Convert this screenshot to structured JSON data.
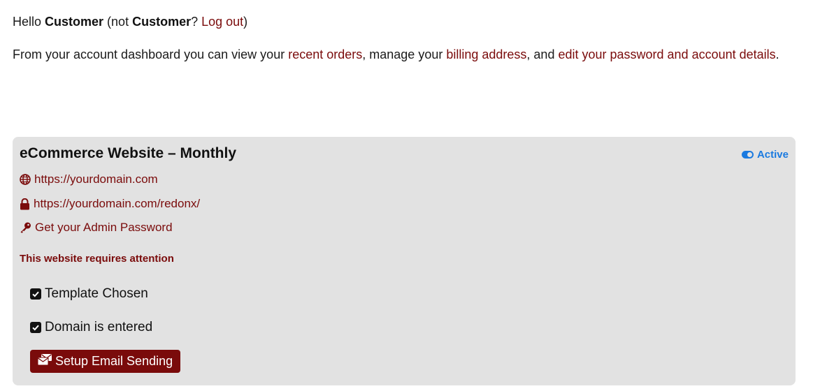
{
  "greeting": {
    "hello": "Hello ",
    "name": "Customer",
    "not_prefix": " (not ",
    "name2": "Customer",
    "question": "? ",
    "logout": "Log out",
    "close": ")"
  },
  "intro": {
    "part1": "From your account dashboard you can view your ",
    "recent_orders": "recent orders",
    "part2": ", manage your ",
    "billing_address": "billing address",
    "part3": ", and ",
    "edit_details": "edit your password and account details",
    "part4": "."
  },
  "site": {
    "title": "eCommerce Website – Monthly",
    "status": "Active",
    "status_color": "#1a7ae0",
    "domain_url": "https://yourdomain.com",
    "admin_url": "https://yourdomain.com/redonx/",
    "password_link": "Get your Admin Password",
    "attention": "This website requires attention",
    "checklist": [
      {
        "label": "Template Chosen",
        "checked": true
      },
      {
        "label": "Domain is entered",
        "checked": true
      }
    ],
    "setup_button": "Setup Email Sending"
  },
  "colors": {
    "accent": "#7a0b0b",
    "card_bg": "#e2e2e2"
  },
  "icons": [
    "globe-icon",
    "lock-icon",
    "key-icon",
    "check-square-icon",
    "envelopes-icon",
    "toggle-on-icon"
  ]
}
